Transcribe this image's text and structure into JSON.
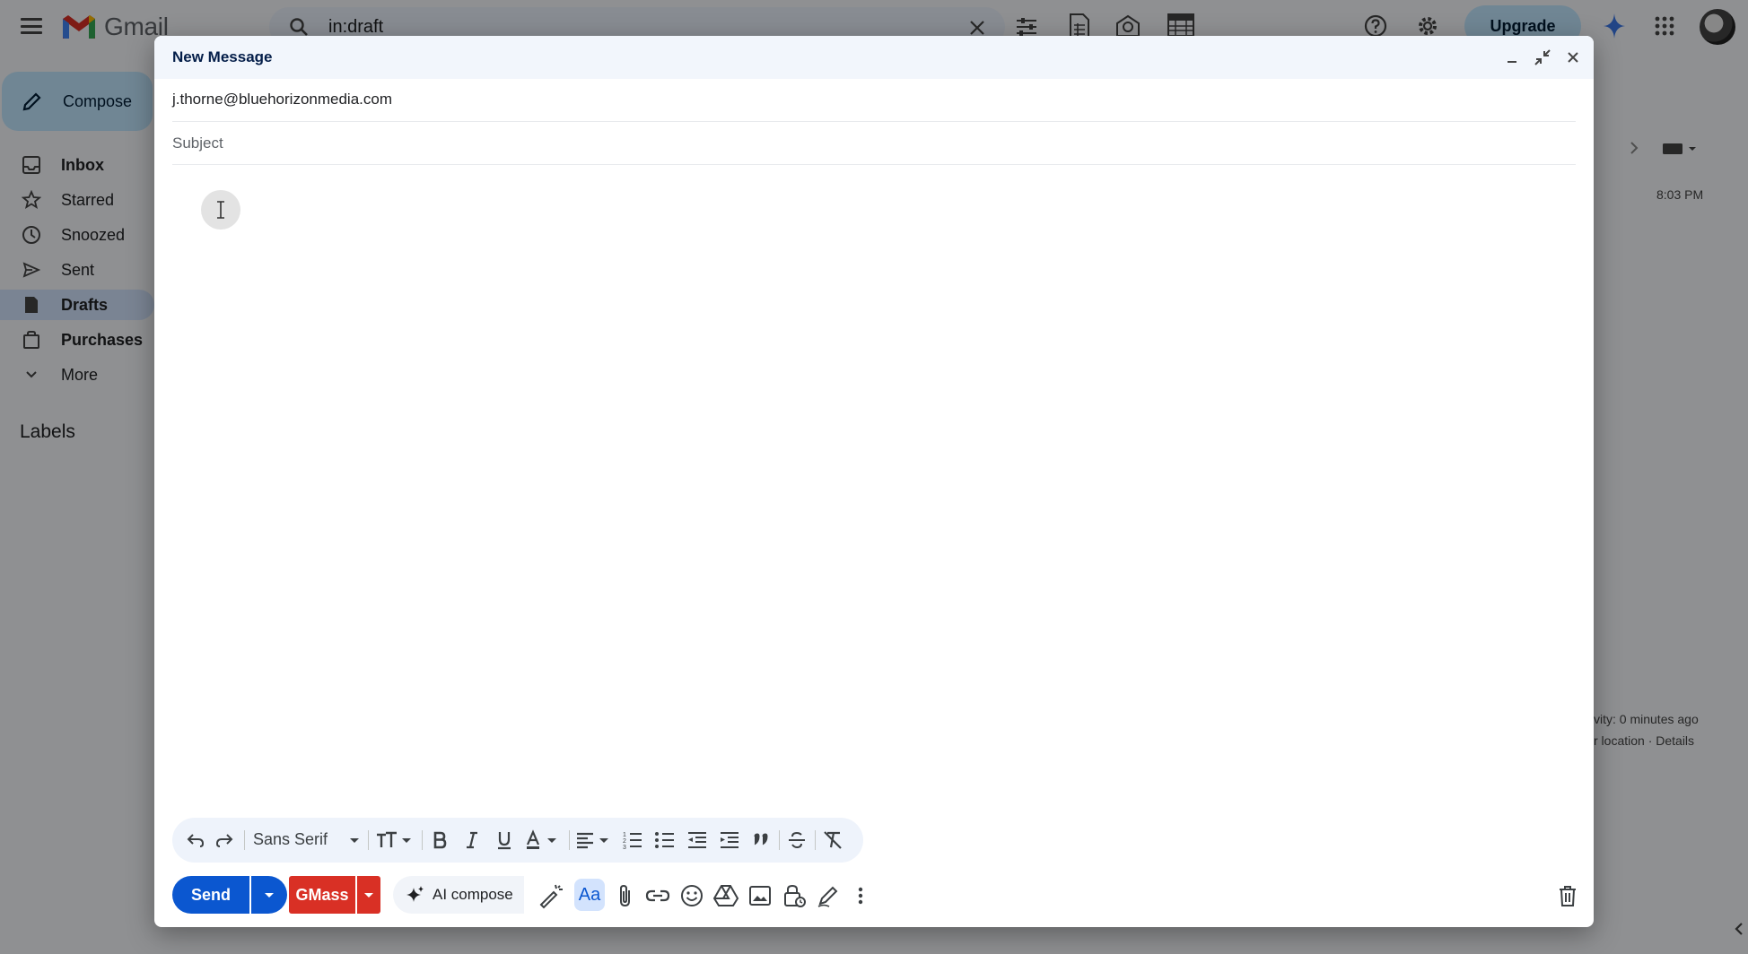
{
  "app": {
    "name": "Gmail",
    "upgrade_label": "Upgrade"
  },
  "search": {
    "query": "in:draft"
  },
  "sidebar": {
    "compose_label": "Compose",
    "items": [
      {
        "label": "Inbox",
        "icon": "inbox-icon",
        "bold": true
      },
      {
        "label": "Starred",
        "icon": "star-icon",
        "bold": false
      },
      {
        "label": "Snoozed",
        "icon": "clock-icon",
        "bold": false
      },
      {
        "label": "Sent",
        "icon": "send-icon",
        "bold": false
      },
      {
        "label": "Drafts",
        "icon": "draft-icon",
        "bold": true,
        "active": true
      },
      {
        "label": "Purchases",
        "icon": "shopping-bag-icon",
        "bold": true
      },
      {
        "label": "More",
        "icon": "chevron-down-icon",
        "bold": false
      }
    ],
    "labels_title": "Labels"
  },
  "mail_list": {
    "time": "8:03 PM",
    "activity": "vity: 0 minutes ago",
    "location": "r location · Details"
  },
  "compose": {
    "title": "New Message",
    "to_value": "j.thorne@bluehorizonmedia.com",
    "subject_placeholder": "Subject",
    "font_name": "Sans Serif",
    "send_label": "Send",
    "gmass_label": "GMass",
    "ai_compose_label": "AI compose",
    "aa_label": "Aa"
  },
  "colors": {
    "send": "#0b57d0",
    "gmass": "#d93025",
    "upgrade": "#c2e7ff"
  }
}
